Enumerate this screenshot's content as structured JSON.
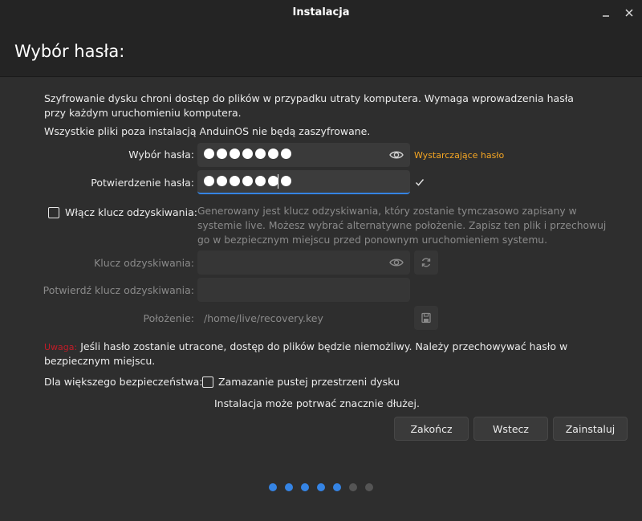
{
  "window": {
    "title": "Instalacja"
  },
  "header": {
    "title": "Wybór hasła:"
  },
  "intro": {
    "line1": "Szyfrowanie dysku chroni dostęp do plików w przypadku utraty komputera. Wymaga wprowadzenia hasła",
    "line2": "przy każdym uruchomieniu komputera.",
    "line3": "Wszystkie pliki poza instalacją AnduinOS nie będą zaszyfrowane."
  },
  "password": {
    "label": "Wybór hasła:",
    "masked_length": 7,
    "strength": "Wystarczające hasło",
    "strength_color": "#f5a623"
  },
  "confirm": {
    "label": "Potwierdzenie hasła:",
    "masked_length": 7
  },
  "recovery": {
    "checkbox_label": "Włącz klucz odzyskiwania:",
    "checked": false,
    "desc1": "Generowany jest klucz odzyskiwania, który zostanie tymczasowo zapisany w",
    "desc2": "systemie live. Możesz wybrać alternatywne położenie. Zapisz ten plik i przechowuj",
    "desc3": "go w bezpiecznym miejscu przed ponownym uruchomieniem systemu.",
    "key_label": "Klucz odzyskiwania:",
    "confirm_label": "Potwierdź klucz odzyskiwania:",
    "location_label": "Położenie:",
    "location_value": "/home/live/recovery.key"
  },
  "warning": {
    "prefix": "Uwaga:",
    "prefix_color": "#c01c28",
    "line1": "Jeśli hasło zostanie utracone, dostęp do plików będzie niemożliwy. Należy przechowywać hasło w",
    "line2": "bezpiecznym miejscu."
  },
  "security": {
    "label": "Dla większego bezpieczeństwa:",
    "checkbox_label": "Zamazanie pustej przestrzeni dysku",
    "checked": false,
    "note": "Instalacja może potrwać znacznie dłużej."
  },
  "buttons": {
    "quit": "Zakończ",
    "back": "Wstecz",
    "install": "Zainstaluj"
  },
  "progress": {
    "total_steps": 7,
    "completed_steps": 5,
    "active_color": "#3584e4",
    "inactive_color": "#555555"
  }
}
